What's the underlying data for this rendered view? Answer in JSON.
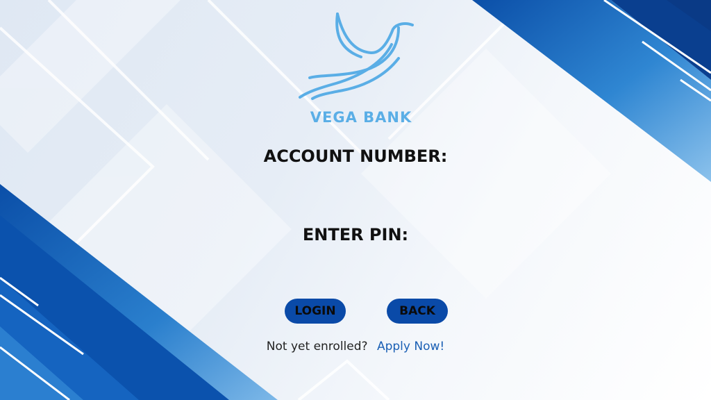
{
  "brand": {
    "name": "VEGA BANK",
    "logo_icon": "dove-icon",
    "colors": {
      "logo": "#5aaee6",
      "button": "#0a4aa8",
      "link": "#1a5fb4",
      "stripe_dark": "#0a4aa8",
      "stripe_light": "#3d8fd6"
    }
  },
  "form": {
    "account_label": "ACCOUNT NUMBER:",
    "pin_label": "ENTER PIN:"
  },
  "buttons": {
    "login": "LOGIN",
    "back": "BACK"
  },
  "enroll": {
    "prompt": "Not yet enrolled?",
    "link": "Apply Now!"
  }
}
